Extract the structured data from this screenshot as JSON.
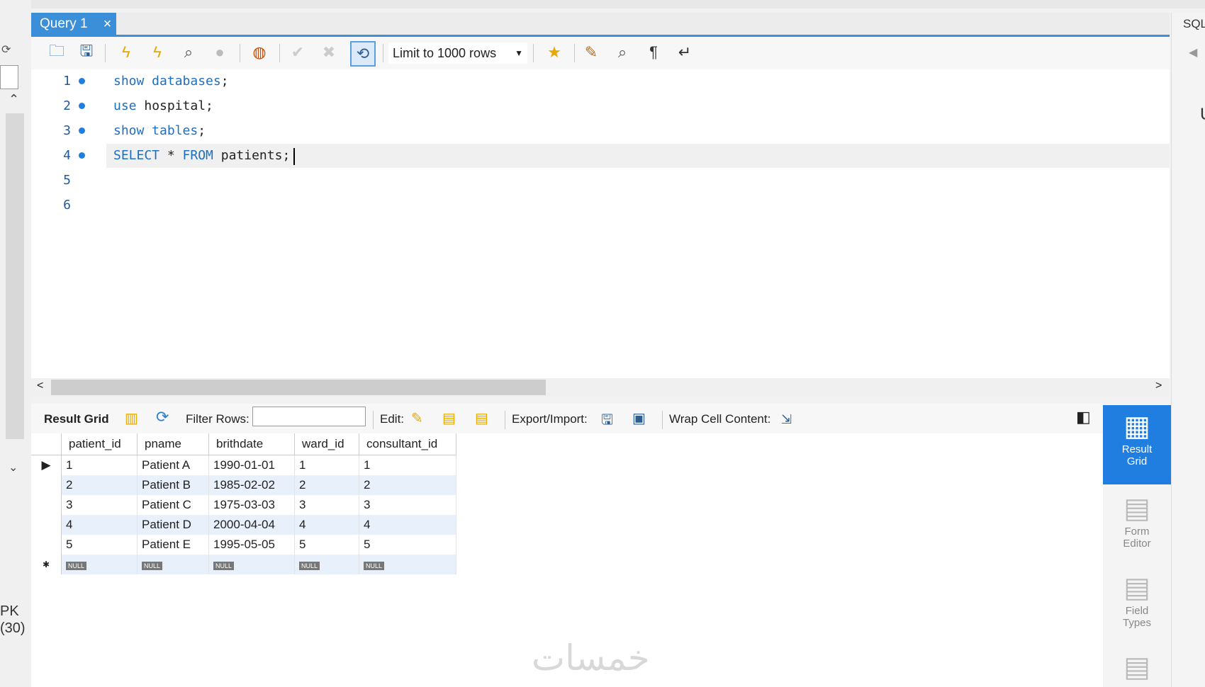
{
  "tab": {
    "title": "Query 1",
    "close": "×"
  },
  "right_panel": {
    "label": "SQL",
    "arrow": "◀",
    "partial": "U"
  },
  "left_panel": {
    "pk": "PK",
    "num": "(30)"
  },
  "toolbar": {
    "limit_label": "Limit to 1000 rows"
  },
  "editor": {
    "lines": [
      {
        "num": "1",
        "kw1": "show databases",
        "rest": ";"
      },
      {
        "num": "2",
        "kw1": "use",
        "rest": " hospital;"
      },
      {
        "num": "3",
        "kw1": "show tables",
        "rest": ";"
      },
      {
        "num": "4",
        "kw1": "SELECT",
        "rest": " * ",
        "kw2": "FROM",
        "rest2": " patients;"
      },
      {
        "num": "5"
      },
      {
        "num": "6"
      }
    ]
  },
  "result_toolbar": {
    "result_grid": "Result Grid",
    "filter_rows": "Filter Rows:",
    "edit": "Edit:",
    "export_import": "Export/Import:",
    "wrap": "Wrap Cell Content:"
  },
  "grid": {
    "columns": [
      "patient_id",
      "pname",
      "brithdate",
      "ward_id",
      "consultant_id"
    ],
    "rows": [
      [
        "1",
        "Patient A",
        "1990-01-01",
        "1",
        "1"
      ],
      [
        "2",
        "Patient B",
        "1985-02-02",
        "2",
        "2"
      ],
      [
        "3",
        "Patient C",
        "1975-03-03",
        "3",
        "3"
      ],
      [
        "4",
        "Patient D",
        "2000-04-04",
        "4",
        "4"
      ],
      [
        "5",
        "Patient E",
        "1995-05-05",
        "5",
        "5"
      ]
    ],
    "null_label": "NULL"
  },
  "side_buttons": {
    "result_grid_1": "Result",
    "result_grid_2": "Grid",
    "form_editor_1": "Form",
    "form_editor_2": "Editor",
    "field_types_1": "Field",
    "field_types_2": "Types"
  },
  "watermark": "خمسات",
  "colors": {
    "accent": "#1f7ee0",
    "keyword": "#1e6fbf"
  }
}
